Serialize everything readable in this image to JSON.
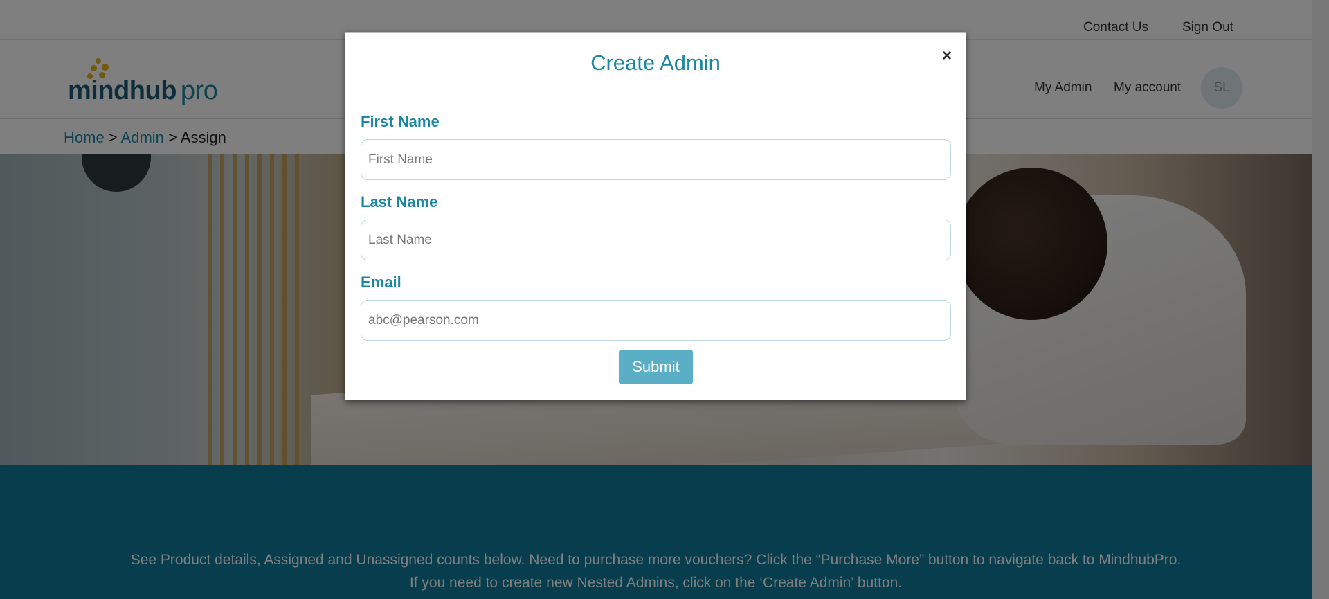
{
  "topbar": {
    "contact_label": "Contact Us",
    "signout_label": "Sign Out"
  },
  "header": {
    "logo_text_mind": "mindhub",
    "logo_text_pro": "pro",
    "nav_admin_label": "My Admin",
    "nav_account_label": "My account",
    "avatar_initials": "SL"
  },
  "breadcrumb": {
    "home": "Home",
    "sep1": " > ",
    "admin": "Admin",
    "sep2": " > ",
    "current": "Assign"
  },
  "info": {
    "text": "See Product details, Assigned and Unassigned counts below. Need to purchase more vouchers? Click the “Purchase More” button to navigate back to MindhubPro. If you need to create new Nested Admins, click on the ‘Create Admin’ button."
  },
  "modal": {
    "title": "Create Admin",
    "close_glyph": "×",
    "first_name_label": "First Name",
    "first_name_placeholder": "First Name",
    "last_name_label": "Last Name",
    "last_name_placeholder": "Last Name",
    "email_label": "Email",
    "email_placeholder": "abc@pearson.com",
    "submit_label": "Submit"
  },
  "colors": {
    "brand_teal": "#1b87a3",
    "info_band": "#0f7b99",
    "submit": "#5aaec5",
    "logo_dot": "#e2b21c"
  }
}
